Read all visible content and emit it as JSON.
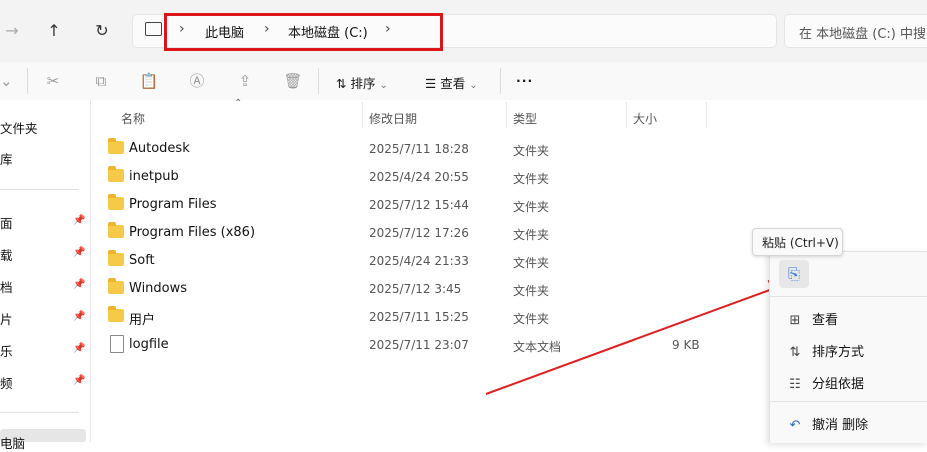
{
  "address": {
    "crumbs": [
      "此电脑",
      "本地磁盘 (C:)"
    ],
    "search_placeholder": "在 本地磁盘 (C:) 中搜"
  },
  "toolbar": {
    "sort_label": "排序",
    "view_label": "查看",
    "more_label": "···"
  },
  "sidebar": {
    "items": [
      "文件夹",
      "库",
      "面",
      "载",
      "档",
      "片",
      "乐",
      "频",
      "电脑"
    ]
  },
  "columns": {
    "name": "名称",
    "modified": "修改日期",
    "type": "类型",
    "size": "大小"
  },
  "files": [
    {
      "name": "Autodesk",
      "modified": "2025/7/11 18:28",
      "type": "文件夹",
      "size": ""
    },
    {
      "name": "inetpub",
      "modified": "2025/4/24 20:55",
      "type": "文件夹",
      "size": ""
    },
    {
      "name": "Program Files",
      "modified": "2025/7/12 15:44",
      "type": "文件夹",
      "size": ""
    },
    {
      "name": "Program Files (x86)",
      "modified": "2025/7/12 17:26",
      "type": "文件夹",
      "size": ""
    },
    {
      "name": "Soft",
      "modified": "2025/4/24 21:33",
      "type": "文件夹",
      "size": ""
    },
    {
      "name": "Windows",
      "modified": "2025/7/12 3:45",
      "type": "文件夹",
      "size": ""
    },
    {
      "name": "用户",
      "modified": "2025/7/11 15:25",
      "type": "文件夹",
      "size": ""
    },
    {
      "name": "logfile",
      "modified": "2025/7/11 23:07",
      "type": "文本文档",
      "size": "9 KB"
    }
  ],
  "context_menu": {
    "tooltip": "粘贴 (Ctrl+V)",
    "view": "查看",
    "sort_by": "排序方式",
    "group_by": "分组依据",
    "undo_delete": "撤消 删除"
  },
  "colors": {
    "highlight_box": "#d9161a",
    "annotation_arrow": "#e02020",
    "folder": "#f7c948"
  }
}
